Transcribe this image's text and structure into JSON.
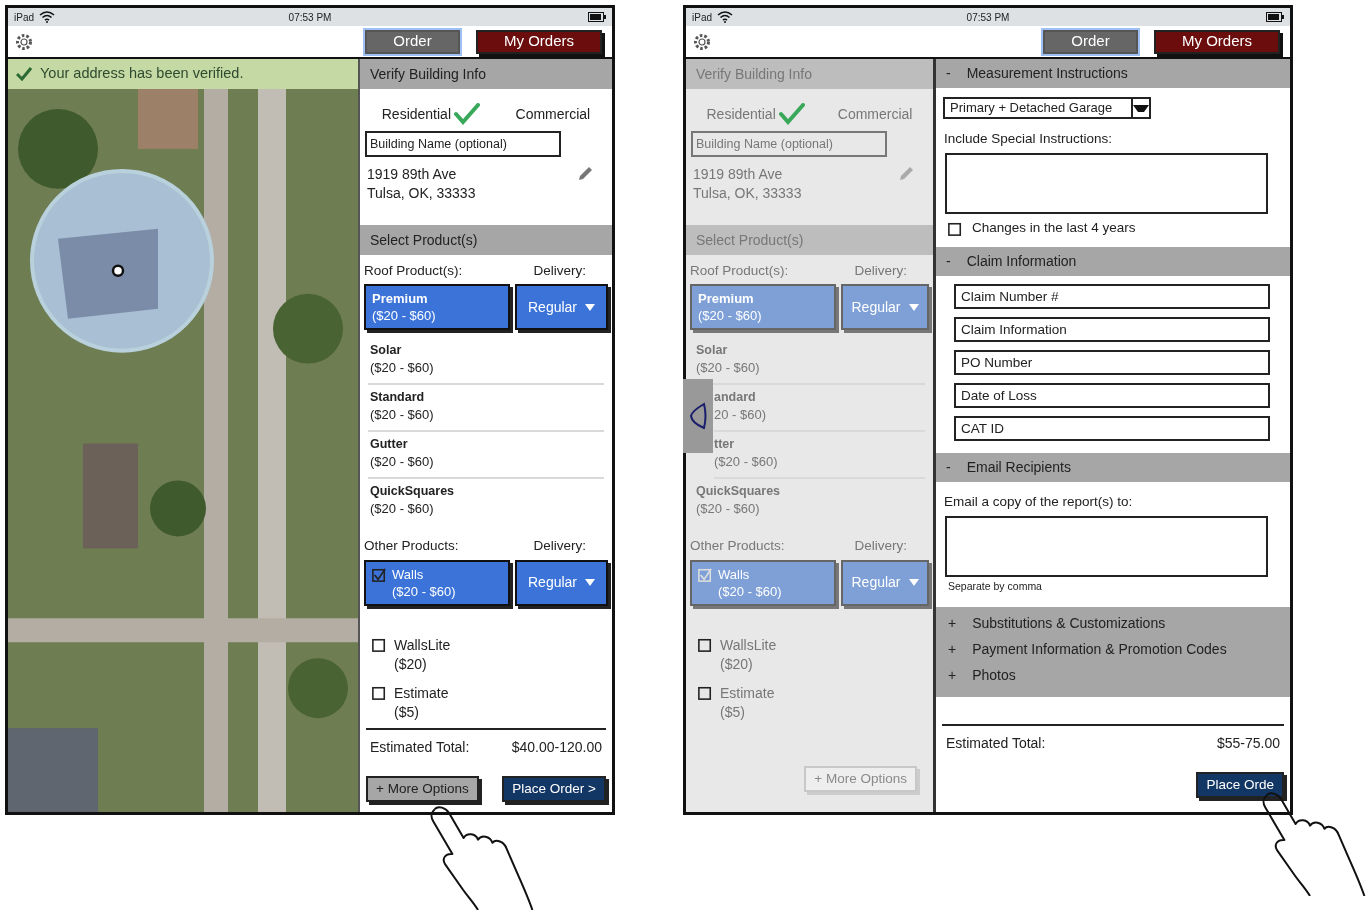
{
  "screens": [
    {
      "status_bar": {
        "device": "iPad",
        "time": "07:53 PM"
      },
      "nav_tabs": [
        {
          "label": "Order",
          "selected": true
        },
        {
          "label": "My Orders",
          "selected": false
        }
      ],
      "banner": {
        "text": "Your address has been verified."
      },
      "map": {
        "kind": "picture"
      },
      "panel": {
        "dimmed": false,
        "title": "Verify Building Info",
        "types": [
          {
            "label": "Residential",
            "selected": true
          },
          {
            "label": "Commercial",
            "selected": false
          }
        ],
        "building_name": {
          "placeholder": "Building Name (optional)"
        },
        "address": [
          "1919 89th Ave",
          "Tulsa, OK, 33333"
        ],
        "products_title": "Select Product(s)",
        "roof_label": "Roof Product(s):",
        "roof_delivery_label": "Delivery:",
        "roof_products": [
          {
            "name": "Premium",
            "price": "($20 - $60)",
            "selected": true,
            "delivery": "Regular"
          },
          {
            "name": "Solar",
            "price": "($20 - $60)",
            "selected": false
          },
          {
            "name": "Standard",
            "price": "($20 - $60)",
            "selected": false
          },
          {
            "name": "Gutter",
            "price": "($20 - $60)",
            "selected": false
          },
          {
            "name": "QuickSquares",
            "price": "($20 - $60)",
            "selected": false
          }
        ],
        "other_label": "Other Products:",
        "other_delivery_label": "Delivery:",
        "other_products": [
          {
            "name": "Walls",
            "price": "($20 - $60)",
            "checked": true,
            "delivery": "Regular"
          },
          {
            "name": "WallsLite",
            "price": "($20)",
            "checked": false
          },
          {
            "name": "Estimate",
            "price": "($5)",
            "checked": false
          }
        ],
        "total": {
          "label": "Estimated Total:",
          "value": "$40.00-120.00"
        },
        "buttons": [
          {
            "label": "+ More Options",
            "kind": "secondary"
          },
          {
            "label": "Place Order >",
            "kind": "primary"
          }
        ]
      }
    },
    {
      "status_bar": {
        "device": "iPad",
        "time": "07:53 PM"
      },
      "nav_tabs": [
        {
          "label": "Order",
          "selected": true
        },
        {
          "label": "My Orders",
          "selected": false
        }
      ],
      "panel": {
        "dimmed": true,
        "title": "Verify Building Info",
        "types": [
          {
            "label": "Residential",
            "selected": true
          },
          {
            "label": "Commercial",
            "selected": false
          }
        ],
        "building_name": {
          "placeholder": "Building Name (optional)"
        },
        "address": [
          "1919 89th Ave",
          "Tulsa, OK, 33333"
        ],
        "products_title": "Select Product(s)",
        "roof_label": "Roof Product(s):",
        "roof_delivery_label": "Delivery:",
        "roof_products": [
          {
            "name": "Premium",
            "price": "($20 - $60)",
            "selected": true,
            "delivery": "Regular"
          },
          {
            "name": "Solar",
            "price": "($20 - $60)",
            "selected": false
          },
          {
            "name": "andard",
            "price": "20 - $60)",
            "selected": false,
            "covered": true
          },
          {
            "name": "tter",
            "price": "($20 - $60)",
            "selected": false,
            "covered": true
          },
          {
            "name": "QuickSquares",
            "price": "($20 - $60)",
            "selected": false
          }
        ],
        "other_label": "Other Products:",
        "other_delivery_label": "Delivery:",
        "other_products": [
          {
            "name": "Walls",
            "price": "($20 - $60)",
            "checked": true,
            "delivery": "Regular"
          },
          {
            "name": "WallsLite",
            "price": "($20)",
            "checked": false
          },
          {
            "name": "Estimate",
            "price": "($5)",
            "checked": false
          }
        ],
        "buttons": [
          {
            "label": "+ More Options",
            "kind": "disabled"
          }
        ]
      },
      "order_panel": {
        "sections": [
          {
            "kind": "measurement",
            "marker": "-",
            "title": "Measurement Instructions",
            "expanded": true,
            "structure": "Primary + Detached Garage",
            "special_label": "Include Special Instructions:",
            "changes": {
              "label": "Changes in the last 4 years",
              "checked": false
            }
          },
          {
            "kind": "claim",
            "marker": "-",
            "title": "Claim Information",
            "expanded": true,
            "fields": [
              {
                "placeholder": "Claim Number #"
              },
              {
                "placeholder": "Claim Information"
              },
              {
                "placeholder": "PO Number"
              },
              {
                "placeholder": "Date of Loss"
              },
              {
                "placeholder": "CAT ID"
              }
            ]
          },
          {
            "kind": "email",
            "marker": "-",
            "title": "Email Recipients",
            "expanded": true,
            "label": "Email a copy of the report(s) to:",
            "hint": "Separate by comma"
          },
          {
            "kind": "plain",
            "marker": "+",
            "title": "Substitutions & Customizations",
            "expanded": false
          },
          {
            "kind": "plain",
            "marker": "+",
            "title": "Payment Information & Promotion Codes",
            "expanded": false
          },
          {
            "kind": "plain",
            "marker": "+",
            "title": "Photos",
            "expanded": false
          }
        ],
        "total": {
          "label": "Estimated Total:",
          "value": "$55-75.00"
        },
        "buttons": [
          {
            "label": "Place Orde",
            "kind": "primary"
          }
        ]
      }
    }
  ]
}
